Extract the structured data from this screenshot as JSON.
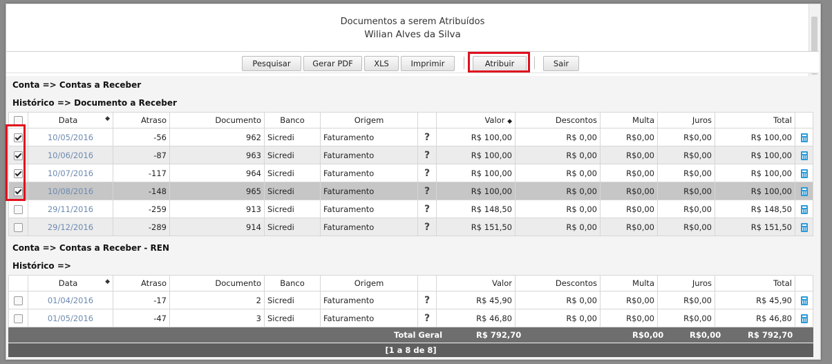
{
  "header": {
    "title": "Documentos a serem Atribuídos",
    "subtitle": "Wilian Alves da Silva"
  },
  "toolbar": {
    "pesquisar": "Pesquisar",
    "gerar_pdf": "Gerar PDF",
    "xls": "XLS",
    "imprimir": "Imprimir",
    "atribuir": "Atribuir",
    "sair": "Sair"
  },
  "columns": {
    "data": "Data",
    "atraso": "Atraso",
    "documento": "Documento",
    "banco": "Banco",
    "origem": "Origem",
    "valor": "Valor",
    "descontos": "Descontos",
    "multa": "Multa",
    "juros": "Juros",
    "total": "Total"
  },
  "group1": {
    "conta": "Conta => Contas a Receber",
    "historico": "Histórico => Documento a Receber",
    "rows": [
      {
        "checked": true,
        "data": "10/05/2016",
        "atraso": "-56",
        "documento": "962",
        "banco": "Sicredi",
        "origem": "Faturamento",
        "valor": "R$ 100,00",
        "descontos": "R$ 0,00",
        "multa": "R$0,00",
        "juros": "R$0,00",
        "total": "R$ 100,00"
      },
      {
        "checked": true,
        "data": "10/06/2016",
        "atraso": "-87",
        "documento": "963",
        "banco": "Sicredi",
        "origem": "Faturamento",
        "valor": "R$ 100,00",
        "descontos": "R$ 0,00",
        "multa": "R$0,00",
        "juros": "R$0,00",
        "total": "R$ 100,00"
      },
      {
        "checked": true,
        "data": "10/07/2016",
        "atraso": "-117",
        "documento": "964",
        "banco": "Sicredi",
        "origem": "Faturamento",
        "valor": "R$ 100,00",
        "descontos": "R$ 0,00",
        "multa": "R$0,00",
        "juros": "R$0,00",
        "total": "R$ 100,00"
      },
      {
        "checked": true,
        "data": "10/08/2016",
        "atraso": "-148",
        "documento": "965",
        "banco": "Sicredi",
        "origem": "Faturamento",
        "valor": "R$ 100,00",
        "descontos": "R$ 0,00",
        "multa": "R$0,00",
        "juros": "R$0,00",
        "total": "R$ 100,00"
      },
      {
        "checked": false,
        "data": "29/11/2016",
        "atraso": "-259",
        "documento": "913",
        "banco": "Sicredi",
        "origem": "Faturamento",
        "valor": "R$ 148,50",
        "descontos": "R$ 0,00",
        "multa": "R$0,00",
        "juros": "R$0,00",
        "total": "R$ 148,50"
      },
      {
        "checked": false,
        "data": "29/12/2016",
        "atraso": "-289",
        "documento": "914",
        "banco": "Sicredi",
        "origem": "Faturamento",
        "valor": "R$ 151,50",
        "descontos": "R$ 0,00",
        "multa": "R$0,00",
        "juros": "R$0,00",
        "total": "R$ 151,50"
      }
    ]
  },
  "group2": {
    "conta": "Conta => Contas a Receber - REN",
    "historico": "Histórico =>",
    "rows": [
      {
        "checked": false,
        "data": "01/04/2016",
        "atraso": "-17",
        "documento": "2",
        "banco": "Sicredi",
        "origem": "Faturamento",
        "valor": "R$ 45,90",
        "descontos": "R$ 0,00",
        "multa": "R$0,00",
        "juros": "R$0,00",
        "total": "R$ 45,90"
      },
      {
        "checked": false,
        "data": "01/05/2016",
        "atraso": "-47",
        "documento": "3",
        "banco": "Sicredi",
        "origem": "Faturamento",
        "valor": "R$ 46,80",
        "descontos": "R$ 0,00",
        "multa": "R$0,00",
        "juros": "R$0,00",
        "total": "R$ 46,80"
      }
    ]
  },
  "totals": {
    "label": "Total Geral",
    "valor": "R$ 792,70",
    "multa": "R$0,00",
    "juros": "R$0,00",
    "total": "R$ 792,70"
  },
  "pager": {
    "text": "[1 a 8 de 8]"
  },
  "icons": {
    "help": "?",
    "calculator": "calculator-icon",
    "checkbox": "checkbox"
  },
  "colors": {
    "highlight": "#e0101e",
    "date_link": "#6d8ab0",
    "calculator": "#2a9bd8",
    "total_bar": "#6e6e6e"
  }
}
